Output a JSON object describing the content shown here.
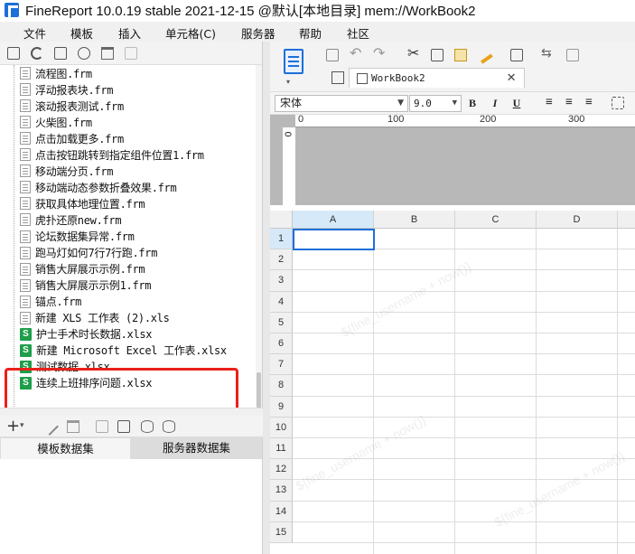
{
  "window": {
    "title": "FineReport 10.0.19 stable 2021-12-15 @默认[本地目录]    mem://WorkBook2"
  },
  "menubar": {
    "items": [
      "文件",
      "模板",
      "插入",
      "单元格(C)",
      "服务器",
      "帮助",
      "社区"
    ]
  },
  "template_tree": {
    "files": [
      {
        "name": "流程图.frm",
        "type": "frm"
      },
      {
        "name": "浮动报表块.frm",
        "type": "frm"
      },
      {
        "name": "滚动报表测试.frm",
        "type": "frm"
      },
      {
        "name": "火柴图.frm",
        "type": "frm"
      },
      {
        "name": "点击加载更多.frm",
        "type": "frm"
      },
      {
        "name": "点击按钮跳转到指定组件位置1.frm",
        "type": "frm"
      },
      {
        "name": "移动端分页.frm",
        "type": "frm"
      },
      {
        "name": "移动端动态参数折叠效果.frm",
        "type": "frm"
      },
      {
        "name": "获取具体地理位置.frm",
        "type": "frm"
      },
      {
        "name": "虎扑还原new.frm",
        "type": "frm"
      },
      {
        "name": "论坛数据集异常.frm",
        "type": "frm"
      },
      {
        "name": "跑马灯如何7行7行跑.frm",
        "type": "frm"
      },
      {
        "name": "销售大屏展示示例.frm",
        "type": "frm"
      },
      {
        "name": "销售大屏展示示例1.frm",
        "type": "frm"
      },
      {
        "name": "锚点.frm",
        "type": "frm"
      },
      {
        "name": "新建 XLS 工作表 (2).xls",
        "type": "xls"
      },
      {
        "name": "护士手术时长数据.xlsx",
        "type": "xlsx"
      },
      {
        "name": "新建 Microsoft Excel 工作表.xlsx",
        "type": "xlsx"
      },
      {
        "name": "测试数据.xlsx",
        "type": "xlsx"
      },
      {
        "name": "连续上班排序问题.xlsx",
        "type": "xlsx"
      }
    ]
  },
  "dataset_tabs": {
    "template": "模板数据集",
    "server": "服务器数据集"
  },
  "editor": {
    "doc_tab": "WorkBook2",
    "font_name": "宋体",
    "font_size": "9.0",
    "bold": "B",
    "italic": "I",
    "underline": "U",
    "ruler_marks": [
      "0",
      "100",
      "200",
      "300"
    ],
    "columns": [
      "A",
      "B",
      "C",
      "D"
    ],
    "rows": [
      "1",
      "2",
      "3",
      "4",
      "5",
      "6",
      "7",
      "8",
      "9",
      "10",
      "11",
      "12",
      "13",
      "14",
      "15"
    ],
    "watermark": "${fine_username + now()}"
  },
  "colors": {
    "accent": "#1e6fd9",
    "highlight": "#e8221b",
    "xlsx_icon": "#1e9e4a"
  }
}
